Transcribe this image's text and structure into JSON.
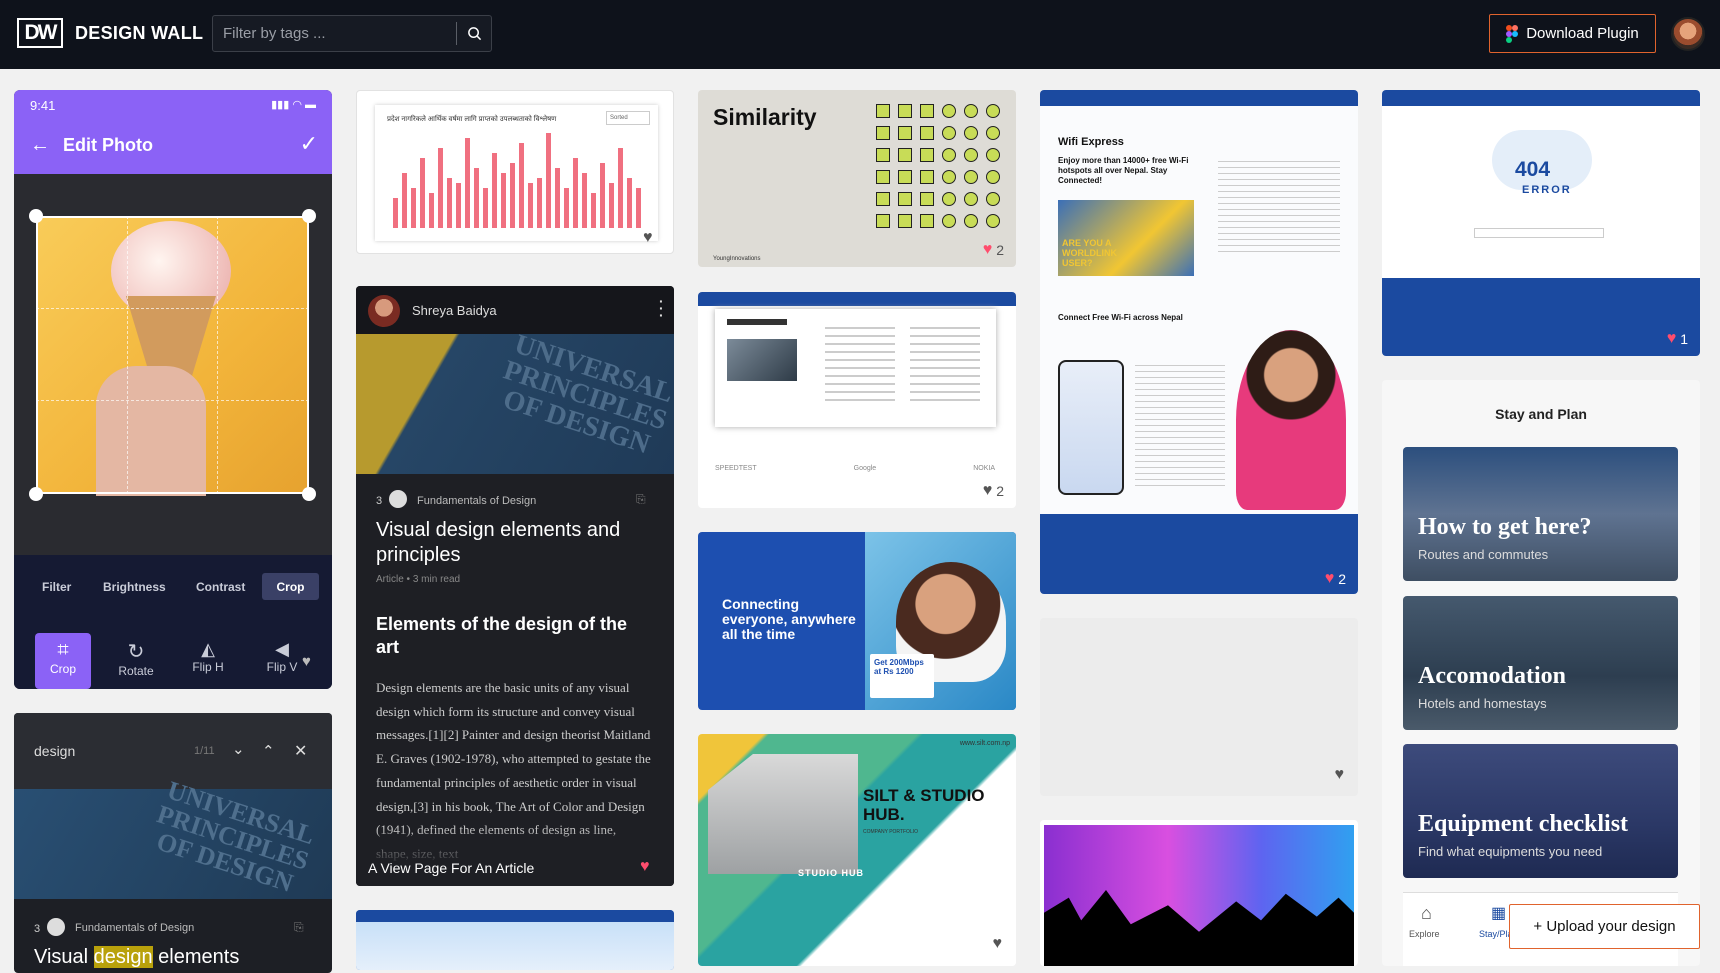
{
  "header": {
    "logo": "DW",
    "brand": "DESIGN WALL",
    "search_placeholder": "Filter by tags ...",
    "download_label": "Download Plugin"
  },
  "col1": {
    "phone": {
      "time": "9:41",
      "title": "Edit Photo",
      "tabs": [
        "Filter",
        "Brightness",
        "Contrast",
        "Crop"
      ],
      "tools": [
        "Crop",
        "Rotate",
        "Flip H",
        "Flip V"
      ]
    },
    "search_panel": {
      "query": "design",
      "count": "1/11",
      "step": "3",
      "pub": "Fundamentals of Design",
      "title_a": "Visual ",
      "title_b": "design",
      "title_c": " elements"
    }
  },
  "col2": {
    "chart_card": {
      "title": "प्रदेश नागरिकले आर्थिक वर्षमा लागि प्राप्तको उपलब्धताको विश्लेषण",
      "select": "Sorted"
    },
    "article": {
      "author": "Shreya Baidya",
      "book": "UNIVERSAL PRINCIPLES OF DESIGN",
      "step": "3",
      "pub": "Fundamentals of Design",
      "title": "Visual design elements and principles",
      "meta": "Article  •  3 min read",
      "h2": "Elements of the design of the art",
      "body": "Design elements are the basic units of any visual design which form its structure and convey visual messages.[1][2] Painter and design theorist Maitland E. Graves (1902-1978), who attempted to gestate the fundamental principles of aesthetic order in visual design,[3] in his book, The Art of Color and Design (1941), defined the elements of design as line, shape, size, text",
      "caption": "A View Page For An Article"
    }
  },
  "col3": {
    "similarity": {
      "title": "Similarity",
      "footer": "YoungInnovations",
      "likes": "2"
    },
    "worldlink_plans": {
      "likes": "2",
      "logos": [
        "SPEEDTEST",
        "Google",
        "NOKIA"
      ]
    },
    "connecting": {
      "headline": "Connecting everyone, anywhere all the time",
      "offer": "Get 200Mbps at Rs 1200"
    },
    "silt": {
      "url": "www.silt.com.np",
      "title": "SILT & STUDIO HUB.",
      "subtitle": "COMPANY PORTFOLIO",
      "studio": "STUDIO HUB",
      "silt": "SILT"
    }
  },
  "col4": {
    "wifi": {
      "crumb": "Wifi Express",
      "title": "Wifi Express",
      "tag": "Enjoy more than 14000+ free Wi-Fi hotspots all over Nepal. Stay Connected!",
      "video": "ARE YOU A WORLDLINK USER?",
      "section": "Connect Free Wi-Fi across Nepal",
      "likes": "2"
    }
  },
  "col5": {
    "error": {
      "code": "404",
      "label": "ERROR",
      "likes": "1"
    },
    "stay": {
      "title": "Stay and Plan",
      "items": [
        {
          "title": "How to get here?",
          "sub": "Routes and commutes"
        },
        {
          "title": "Accomodation",
          "sub": "Hotels and homestays"
        },
        {
          "title": "Equipment checklist",
          "sub": "Find what equipments you need"
        }
      ],
      "nav": [
        "Explore",
        "Stay/Plan"
      ]
    },
    "upload_label": "+ Upload your design"
  }
}
